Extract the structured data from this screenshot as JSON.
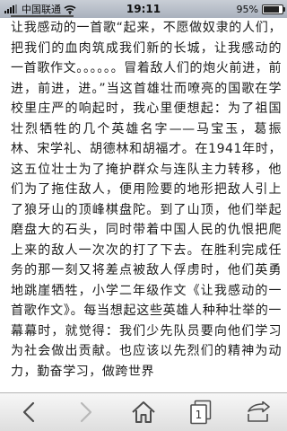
{
  "status_bar": {
    "carrier": "中国联通",
    "time": "19:11",
    "battery_percent": "95%",
    "battery_level": 0.95,
    "icons": [
      "signal-icon",
      "wifi-icon",
      "battery-icon"
    ]
  },
  "article": {
    "text": "让我感动的一首歌“起来，不愿做奴隶的人们，把我们的血肉筑成我们新的长城，让我感动的一首歌作文。。。。。。冒着敌人们的炮火前进，前进，前进，进。”当这首雄壮而嘹亮的国歌在学校里庄严的响起时，我心里便想起：为了祖国壮烈牺牲的几个英雄名字——马宝玉，葛振林、宋学礼、胡德林和胡福才。在1941年时，这五位壮士为了掩护群众与连队主力转移，他们为了拖住敌人，便用险要的地形把敌人引上了狼牙山的顶峰棋盘陀。到了山顶，他们举起磨盘大的石头，同时带着中国人民的仇恨把爬上来的敌人一次次的打了下去。在胜利完成任务的那一刻又将差点被敌人俘虏时，他们英勇地跳崖牺牲，小学二年级作文《让我感动的一首歌作文》。每当想起这些英雄人种种壮举的一幕幕时，就觉得：我们少先队员要向他们学习为社会做出贡献。也应该以先烈们的精神为动力，勤奋学习，做跨世界"
  },
  "toolbar": {
    "back_icon": "back-arrow-icon",
    "forward_icon": "forward-arrow-icon",
    "home_icon": "home-icon",
    "pages_icon": "pages-icon",
    "pages_count": "1",
    "share_icon": "share-icon"
  },
  "colors": {
    "status_bar": "#b3bac5",
    "toolbar": "#ececec",
    "text": "#1b1b1b",
    "icon": "#5a5a5a"
  }
}
